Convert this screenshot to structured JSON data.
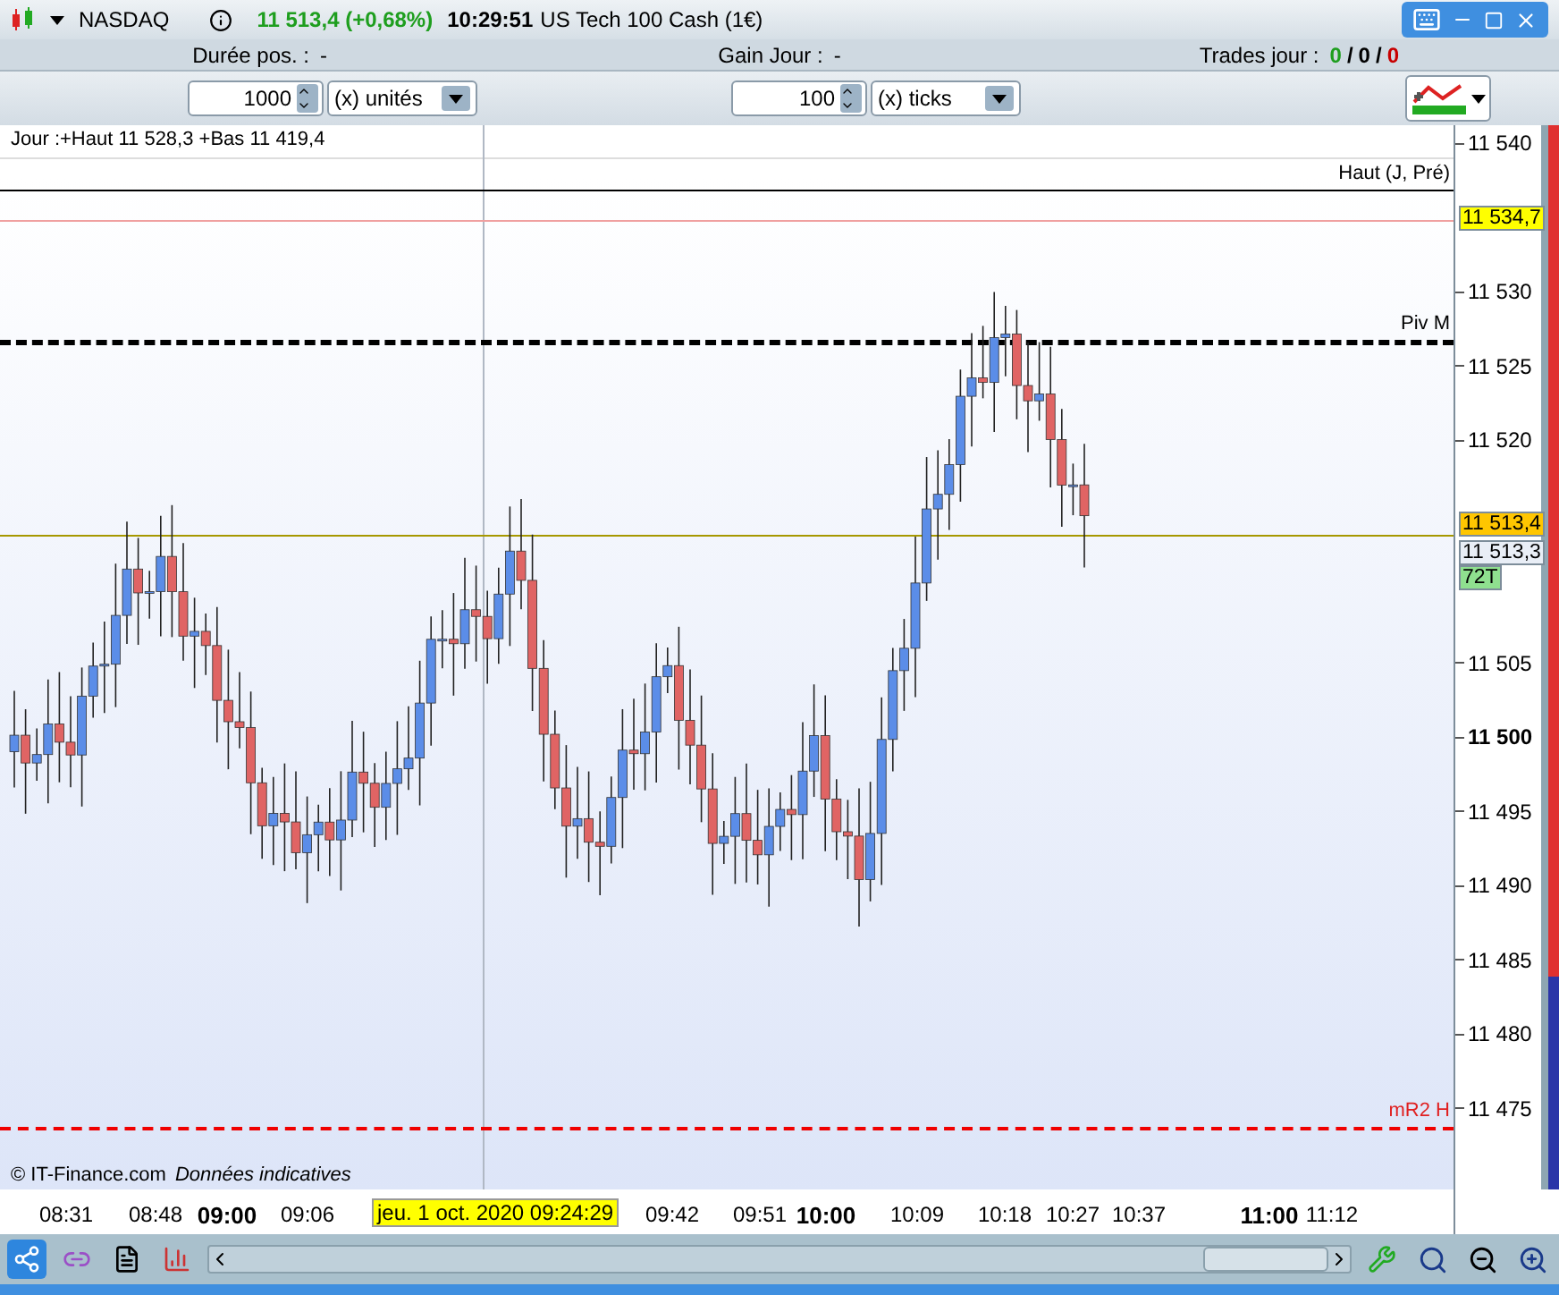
{
  "titlebar": {
    "instrument": "NASDAQ",
    "price": "11 513,4 (+0,68%)",
    "time": "10:29:51",
    "title": "US Tech 100 Cash (1€)"
  },
  "stats": [
    {
      "label": "Durée pos. :",
      "value": "-"
    },
    {
      "label": "Gain Jour :",
      "value": "-"
    }
  ],
  "trades": {
    "label": "Trades jour :",
    "separator": "/",
    "values": [
      {
        "value": "0",
        "color": "#1e9e1e"
      },
      {
        "value": "0",
        "color": "#000000"
      },
      {
        "value": "0",
        "color": "#c80000"
      }
    ]
  },
  "order_controls": [
    {
      "quantity": "1000",
      "unit": "(x) unités"
    },
    {
      "quantity": "100",
      "unit": "(x) ticks"
    }
  ],
  "chart": {
    "header": "Jour :+Haut 11 528,3 +Bas 11 419,4",
    "levels": [
      {
        "label": "Haut (J, Pré)",
        "kind": "solid"
      },
      {
        "kind": "thin"
      },
      {
        "label": "Piv M",
        "kind": "dotted"
      },
      {
        "kind": "last"
      },
      {
        "label": "mR2 H",
        "kind": "dashed"
      }
    ],
    "price_tags": [
      {
        "text": "11 534,7",
        "kind": "high"
      },
      {
        "text": "11 513,4",
        "kind": "last"
      },
      {
        "text": "11 513,3",
        "kind": "bid"
      },
      {
        "text": "72T",
        "kind": "ticks"
      }
    ],
    "y_ticks": [
      {
        "label": "11 540",
        "bold": false
      },
      {
        "label": "11 530",
        "bold": false
      },
      {
        "label": "11 525",
        "bold": false
      },
      {
        "label": "11 520",
        "bold": false
      },
      {
        "label": "11 505",
        "bold": false
      },
      {
        "label": "11 500",
        "bold": true
      },
      {
        "label": "11 495",
        "bold": false
      },
      {
        "label": "11 490",
        "bold": false
      },
      {
        "label": "11 485",
        "bold": false
      },
      {
        "label": "11 480",
        "bold": false
      },
      {
        "label": "11 475",
        "bold": false
      }
    ],
    "x_ticks": [
      {
        "label": "08:31",
        "bold": false
      },
      {
        "label": "08:48",
        "bold": false
      },
      {
        "label": "09:00",
        "bold": true
      },
      {
        "label": "09:06",
        "bold": false
      },
      {
        "label": "09:42",
        "bold": false
      },
      {
        "label": "09:51",
        "bold": false
      },
      {
        "label": "10:00",
        "bold": true
      },
      {
        "label": "10:09",
        "bold": false
      },
      {
        "label": "10:18",
        "bold": false
      },
      {
        "label": "10:27",
        "bold": false
      },
      {
        "label": "10:37",
        "bold": false
      },
      {
        "label": "11:00",
        "bold": true
      },
      {
        "label": "11:12",
        "bold": false
      }
    ],
    "crosshair_label": "jeu. 1 oct. 2020 09:24:29",
    "copyright": "© IT-Finance.com",
    "disclaimer": "Données indicatives"
  }
}
